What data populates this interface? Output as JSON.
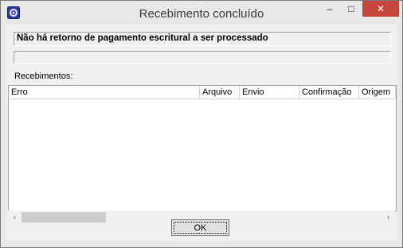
{
  "window": {
    "title": "Recebimento concluído",
    "minimize": "–",
    "maximize": "□",
    "close": "✕"
  },
  "status": {
    "message": "Não há retorno de pagamento escritural a ser processado",
    "progress": 0
  },
  "list": {
    "label": "Recebimentos:",
    "columns": [
      "Erro",
      "Arquivo",
      "Envio",
      "Confirmação",
      "Origem"
    ]
  },
  "scroll": {
    "left": "‹",
    "right": "›"
  },
  "buttons": {
    "ok": "OK"
  },
  "colors": {
    "close_bg": "#c7463c",
    "window_bg": "#e8e8e8",
    "client_bg": "#f0f0f0"
  },
  "icons": {
    "app": "app-icon"
  }
}
